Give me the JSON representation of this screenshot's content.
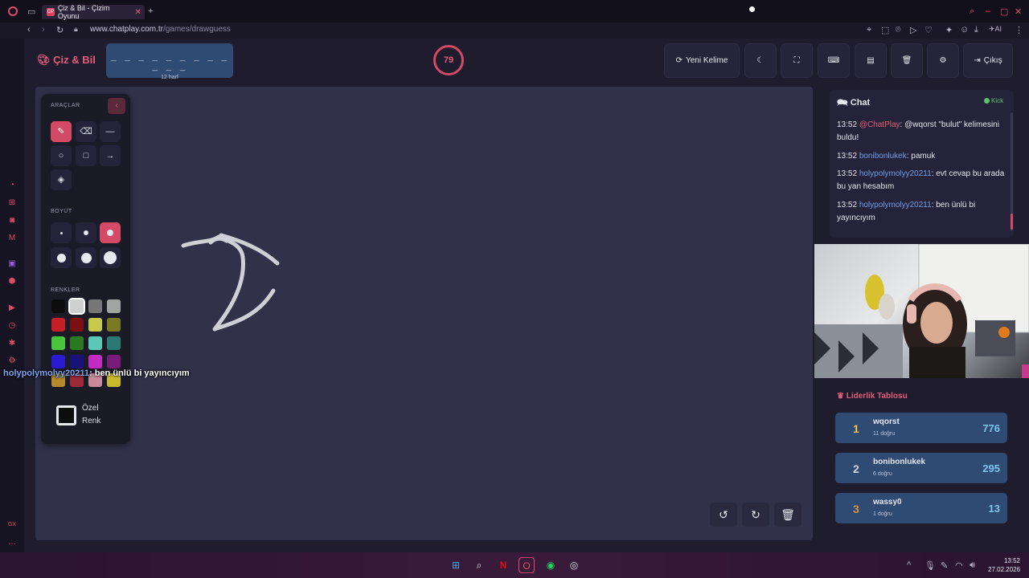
{
  "browser": {
    "tab_title": "Çiz & Bil - Çizim Oyunu",
    "tab_favicon": "CP",
    "url_domain": "www.chatplay.com.tr",
    "url_path": "/games/drawguess"
  },
  "header": {
    "logo": "Çiz & Bil",
    "word_dashes": "_ _ _ _ _ _ _ _ _ _ _ _",
    "word_hint": "12 harf",
    "timer": "79",
    "new_word": "Yeni Kelime",
    "exit": "Çıkış"
  },
  "tools": {
    "section_tools": "ARAÇLAR",
    "section_size": "BOYUT",
    "section_colors": "RENKLER",
    "custom_color_line1": "Özel",
    "custom_color_line2": "Renk",
    "colors": [
      "#0d0d0d",
      "#cfcfcf",
      "#777777",
      "#a3a3a3",
      "#c41f24",
      "#7a1014",
      "#c8c84a",
      "#7a7a22",
      "#4ac43a",
      "#2a7a22",
      "#5ac9b7",
      "#2a7a72",
      "#2a1ad0",
      "#1a1278",
      "#c42ac4",
      "#7a1a7a",
      "#b58a2a",
      "#9a2a3a",
      "#c88a9a",
      "#c8b82a"
    ]
  },
  "overlay": {
    "user": "holypolymolyy20211",
    "text": ": ben ünlü bi yayıncıyım"
  },
  "chat": {
    "title": "Chat",
    "status": "Kick",
    "messages": [
      {
        "time": "13:52",
        "user": "@ChatPlay",
        "text": ": @wqorst \"bulut\" kelimesini buldu!"
      },
      {
        "time": "13:52",
        "user": "bonibonlukek",
        "text": ": pamuk"
      },
      {
        "time": "13:52",
        "user": "holypolymolyy20211",
        "text": ": evt cevap bu arada bu yan hesabım"
      },
      {
        "time": "13:52",
        "user": "holypolymolyy20211",
        "text": ": ben ünlü bi yayıncıyım"
      }
    ]
  },
  "leaderboard": {
    "title": "Liderlik Tablosu",
    "rows": [
      {
        "rank": "1",
        "name": "wqorst",
        "sub": "11 doğru",
        "score": "776"
      },
      {
        "rank": "2",
        "name": "bonibonlukek",
        "sub": "6 doğru",
        "score": "295"
      },
      {
        "rank": "3",
        "name": "wassy0",
        "sub": "1 doğru",
        "score": "13"
      }
    ]
  },
  "taskbar": {
    "time": "13:52",
    "date": "27.02.2026"
  },
  "colors": {
    "accent": "#e35d7a",
    "panel": "#25233a",
    "canvas": "#32314a"
  }
}
